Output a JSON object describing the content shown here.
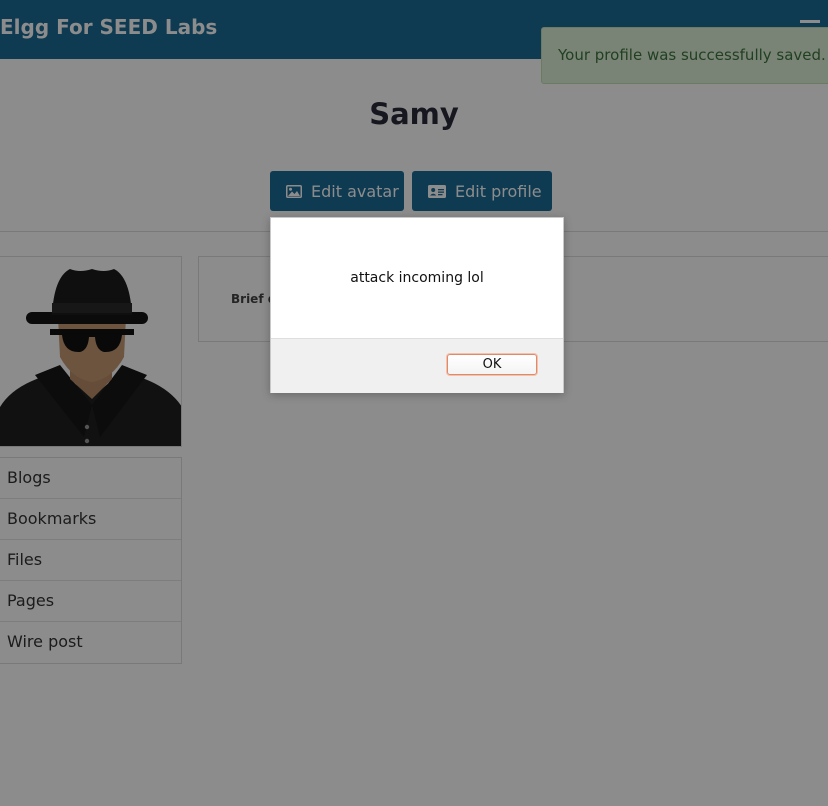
{
  "header": {
    "site_title": "Elgg For SEED Labs",
    "menu_icon": "hamburger-icon",
    "bar_color": "#1a6a96"
  },
  "notification": {
    "text": "Your profile was successfully saved."
  },
  "profile": {
    "name": "Samy",
    "edit_avatar_label": "Edit avatar",
    "edit_profile_label": "Edit profile",
    "brief_label": "Brief d"
  },
  "owner_menu": {
    "items": [
      "Blogs",
      "Bookmarks",
      "Files",
      "Pages",
      "Wire post"
    ]
  },
  "dialog": {
    "message": "attack incoming lol",
    "ok_label": "OK"
  }
}
